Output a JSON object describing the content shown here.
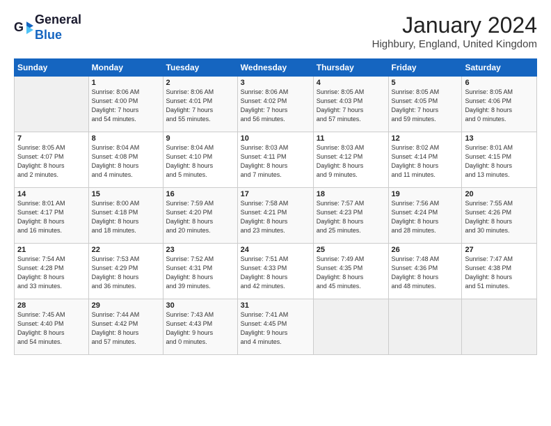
{
  "header": {
    "logo_line1": "General",
    "logo_line2": "Blue",
    "month": "January 2024",
    "location": "Highbury, England, United Kingdom"
  },
  "weekdays": [
    "Sunday",
    "Monday",
    "Tuesday",
    "Wednesday",
    "Thursday",
    "Friday",
    "Saturday"
  ],
  "weeks": [
    [
      {
        "day": "",
        "info": ""
      },
      {
        "day": "1",
        "info": "Sunrise: 8:06 AM\nSunset: 4:00 PM\nDaylight: 7 hours\nand 54 minutes."
      },
      {
        "day": "2",
        "info": "Sunrise: 8:06 AM\nSunset: 4:01 PM\nDaylight: 7 hours\nand 55 minutes."
      },
      {
        "day": "3",
        "info": "Sunrise: 8:06 AM\nSunset: 4:02 PM\nDaylight: 7 hours\nand 56 minutes."
      },
      {
        "day": "4",
        "info": "Sunrise: 8:05 AM\nSunset: 4:03 PM\nDaylight: 7 hours\nand 57 minutes."
      },
      {
        "day": "5",
        "info": "Sunrise: 8:05 AM\nSunset: 4:05 PM\nDaylight: 7 hours\nand 59 minutes."
      },
      {
        "day": "6",
        "info": "Sunrise: 8:05 AM\nSunset: 4:06 PM\nDaylight: 8 hours\nand 0 minutes."
      }
    ],
    [
      {
        "day": "7",
        "info": "Sunrise: 8:05 AM\nSunset: 4:07 PM\nDaylight: 8 hours\nand 2 minutes."
      },
      {
        "day": "8",
        "info": "Sunrise: 8:04 AM\nSunset: 4:08 PM\nDaylight: 8 hours\nand 4 minutes."
      },
      {
        "day": "9",
        "info": "Sunrise: 8:04 AM\nSunset: 4:10 PM\nDaylight: 8 hours\nand 5 minutes."
      },
      {
        "day": "10",
        "info": "Sunrise: 8:03 AM\nSunset: 4:11 PM\nDaylight: 8 hours\nand 7 minutes."
      },
      {
        "day": "11",
        "info": "Sunrise: 8:03 AM\nSunset: 4:12 PM\nDaylight: 8 hours\nand 9 minutes."
      },
      {
        "day": "12",
        "info": "Sunrise: 8:02 AM\nSunset: 4:14 PM\nDaylight: 8 hours\nand 11 minutes."
      },
      {
        "day": "13",
        "info": "Sunrise: 8:01 AM\nSunset: 4:15 PM\nDaylight: 8 hours\nand 13 minutes."
      }
    ],
    [
      {
        "day": "14",
        "info": "Sunrise: 8:01 AM\nSunset: 4:17 PM\nDaylight: 8 hours\nand 16 minutes."
      },
      {
        "day": "15",
        "info": "Sunrise: 8:00 AM\nSunset: 4:18 PM\nDaylight: 8 hours\nand 18 minutes."
      },
      {
        "day": "16",
        "info": "Sunrise: 7:59 AM\nSunset: 4:20 PM\nDaylight: 8 hours\nand 20 minutes."
      },
      {
        "day": "17",
        "info": "Sunrise: 7:58 AM\nSunset: 4:21 PM\nDaylight: 8 hours\nand 23 minutes."
      },
      {
        "day": "18",
        "info": "Sunrise: 7:57 AM\nSunset: 4:23 PM\nDaylight: 8 hours\nand 25 minutes."
      },
      {
        "day": "19",
        "info": "Sunrise: 7:56 AM\nSunset: 4:24 PM\nDaylight: 8 hours\nand 28 minutes."
      },
      {
        "day": "20",
        "info": "Sunrise: 7:55 AM\nSunset: 4:26 PM\nDaylight: 8 hours\nand 30 minutes."
      }
    ],
    [
      {
        "day": "21",
        "info": "Sunrise: 7:54 AM\nSunset: 4:28 PM\nDaylight: 8 hours\nand 33 minutes."
      },
      {
        "day": "22",
        "info": "Sunrise: 7:53 AM\nSunset: 4:29 PM\nDaylight: 8 hours\nand 36 minutes."
      },
      {
        "day": "23",
        "info": "Sunrise: 7:52 AM\nSunset: 4:31 PM\nDaylight: 8 hours\nand 39 minutes."
      },
      {
        "day": "24",
        "info": "Sunrise: 7:51 AM\nSunset: 4:33 PM\nDaylight: 8 hours\nand 42 minutes."
      },
      {
        "day": "25",
        "info": "Sunrise: 7:49 AM\nSunset: 4:35 PM\nDaylight: 8 hours\nand 45 minutes."
      },
      {
        "day": "26",
        "info": "Sunrise: 7:48 AM\nSunset: 4:36 PM\nDaylight: 8 hours\nand 48 minutes."
      },
      {
        "day": "27",
        "info": "Sunrise: 7:47 AM\nSunset: 4:38 PM\nDaylight: 8 hours\nand 51 minutes."
      }
    ],
    [
      {
        "day": "28",
        "info": "Sunrise: 7:45 AM\nSunset: 4:40 PM\nDaylight: 8 hours\nand 54 minutes."
      },
      {
        "day": "29",
        "info": "Sunrise: 7:44 AM\nSunset: 4:42 PM\nDaylight: 8 hours\nand 57 minutes."
      },
      {
        "day": "30",
        "info": "Sunrise: 7:43 AM\nSunset: 4:43 PM\nDaylight: 9 hours\nand 0 minutes."
      },
      {
        "day": "31",
        "info": "Sunrise: 7:41 AM\nSunset: 4:45 PM\nDaylight: 9 hours\nand 4 minutes."
      },
      {
        "day": "",
        "info": ""
      },
      {
        "day": "",
        "info": ""
      },
      {
        "day": "",
        "info": ""
      }
    ]
  ]
}
